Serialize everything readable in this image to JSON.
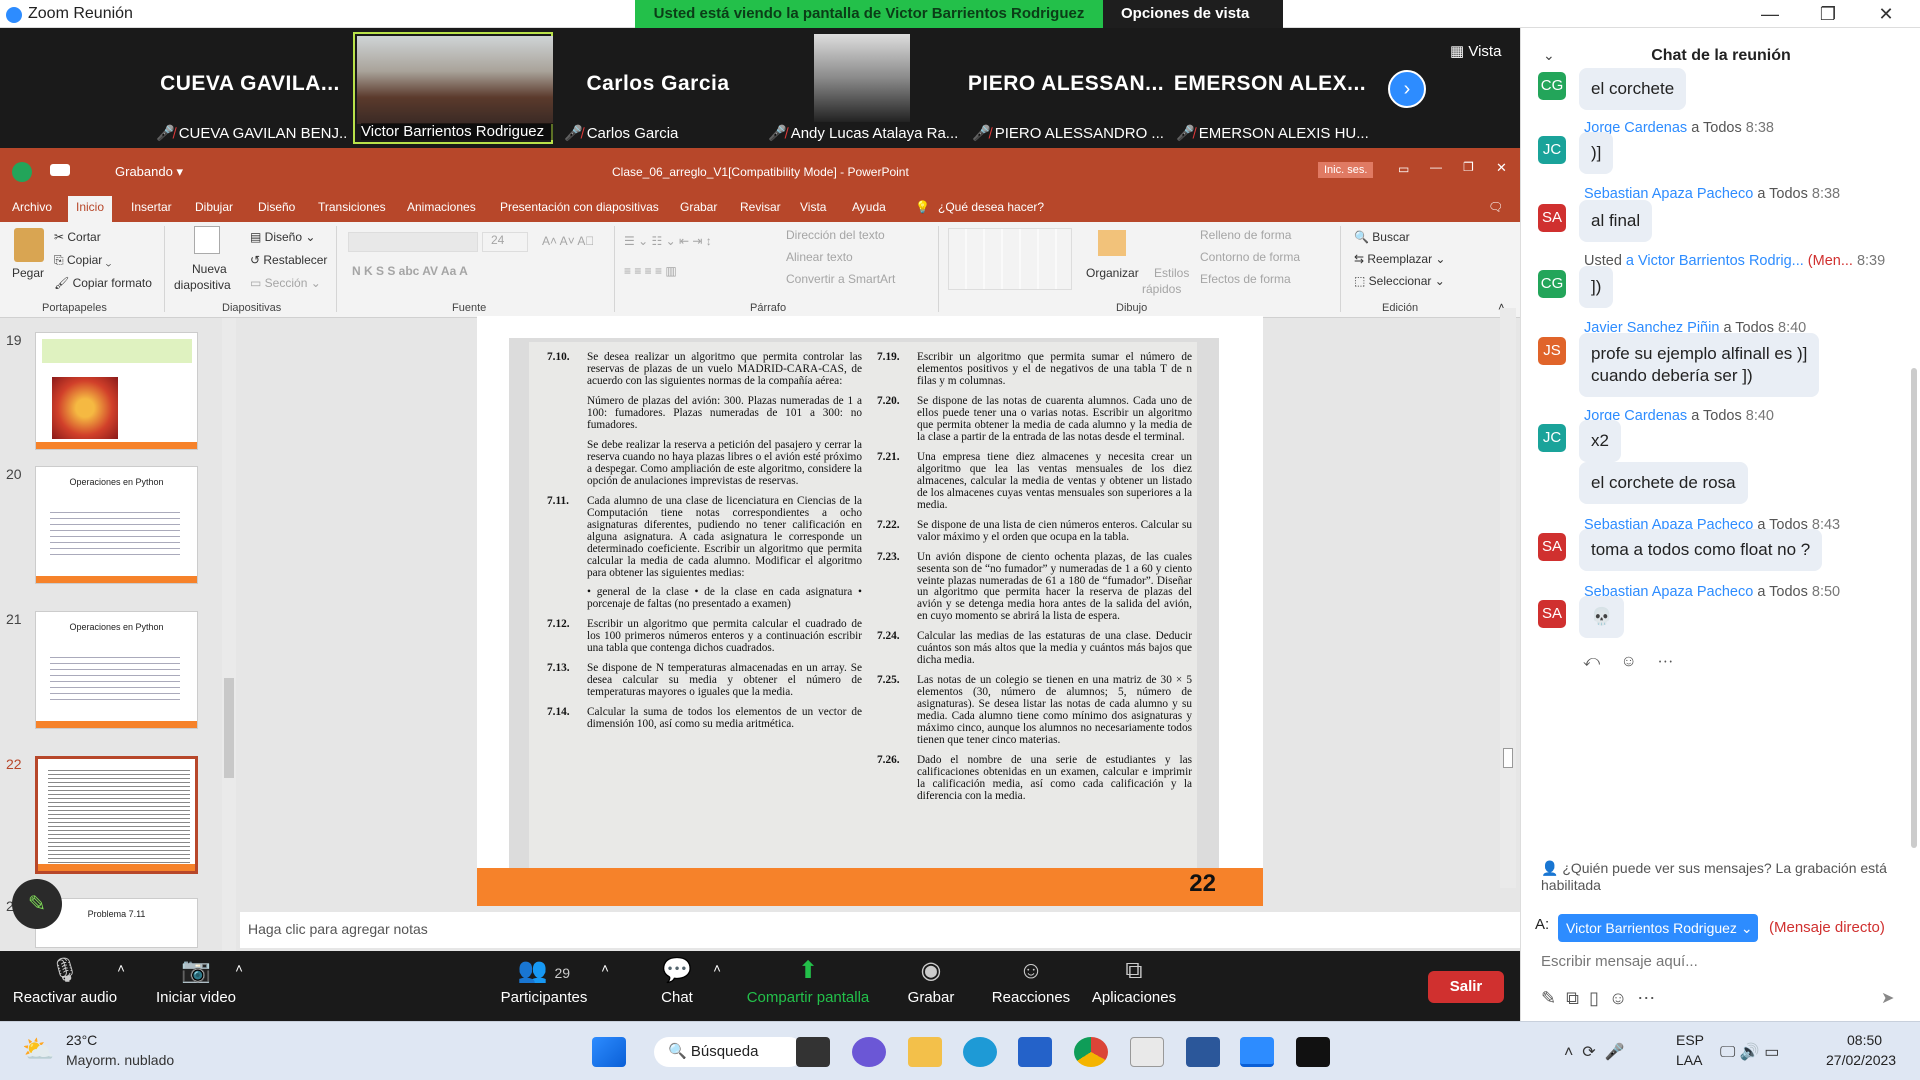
{
  "window": {
    "title": "Zoom Reunión",
    "banner": "Usted está viendo la pantalla de Victor Barrientos Rodriguez",
    "view_options": "Opciones de vista"
  },
  "gallery": {
    "tiles": [
      {
        "big": "CUEVA  GAVILA...",
        "label": "CUEVA GAVILAN BENJ..."
      },
      {
        "big": "",
        "label": "Victor Barrientos Rodriguez"
      },
      {
        "big": "Carlos Garcia",
        "label": "Carlos Garcia"
      },
      {
        "big": "",
        "label": "Andy Lucas Atalaya Ra..."
      },
      {
        "big": "PIERO  ALESSAN...",
        "label": "PIERO ALESSANDRO ..."
      },
      {
        "big": "EMERSON  ALEX...",
        "label": "EMERSON ALEXIS HU..."
      }
    ],
    "view_label": "Vista"
  },
  "ppt": {
    "recording": "Grabando",
    "doc_title": "Clase_06_arreglo_V1[Compatibility Mode]  -  PowerPoint",
    "signin": "Inic. ses.",
    "menu": [
      "Archivo",
      "Inicio",
      "Insertar",
      "Dibujar",
      "Diseño",
      "Transiciones",
      "Animaciones",
      "Presentación con diapositivas",
      "Grabar",
      "Revisar",
      "Vista",
      "Ayuda",
      "¿Qué desea hacer?"
    ],
    "ribbon": {
      "pegar": "Pegar",
      "cortar": "Cortar",
      "copiar": "Copiar",
      "copiar_formato": "Copiar formato",
      "nueva": "Nueva",
      "diapositiva": "diapositiva",
      "diseno": "Diseño",
      "restablecer": "Restablecer",
      "seccion": "Sección",
      "font_size": "24",
      "direccion": "Dirección del texto",
      "alinear": "Alinear texto",
      "smartart": "Convertir a SmartArt",
      "organizar": "Organizar",
      "estilos": "Estilos",
      "rapidos": "rápidos",
      "relleno": "Relleno de forma",
      "contorno": "Contorno de forma",
      "efectos": "Efectos de forma",
      "buscar": "Buscar",
      "reemplazar": "Reemplazar",
      "seleccionar": "Seleccionar",
      "groups": [
        "Portapapeles",
        "Diapositivas",
        "Fuente",
        "Párrafo",
        "Dibujo",
        "Edición"
      ]
    },
    "thumbs": [
      {
        "num": "19",
        "heading": ""
      },
      {
        "num": "20",
        "heading": "Operaciones  en Python"
      },
      {
        "num": "21",
        "heading": "Operaciones  en Python"
      },
      {
        "num": "22",
        "heading": ""
      },
      {
        "num": "23",
        "heading": "Problema 7.11"
      }
    ],
    "notes": "Haga clic para agregar notas",
    "slide_number": "22"
  },
  "page_text": {
    "left": [
      {
        "n": "7.10.",
        "t": "Se desea realizar un algoritmo que permita controlar las reservas de plazas de un vuelo MADRID-CARA-CAS, de acuerdo con las siguientes normas de la compañía aérea:"
      },
      {
        "n": "",
        "t": "Número de plazas del avión: 300. Plazas numeradas de 1 a 100: fumadores. Plazas numeradas de 101 a 300: no fumadores."
      },
      {
        "n": "",
        "t": "Se debe realizar la reserva a petición del pasajero y cerrar la reserva cuando no haya plazas libres o el avión esté próximo a despegar. Como ampliación de este algoritmo, considere la opción de anulaciones imprevistas de reservas."
      },
      {
        "n": "7.11.",
        "t": "Cada alumno de una clase de licenciatura en Ciencias de la Computación tiene notas correspondientes a ocho asignaturas diferentes, pudiendo no tener calificación en alguna asignatura. A cada asignatura le corresponde un determinado coeficiente. Escribir un algoritmo que permita calcular la media de cada alumno. Modificar el algoritmo para obtener las siguientes medias:"
      },
      {
        "n": "",
        "t": "• general de la clase • de la clase en cada asignatura • porcenaje de faltas (no presentado a examen)"
      },
      {
        "n": "7.12.",
        "t": "Escribir un algoritmo que permita calcular el cuadrado de los 100 primeros números enteros y a continuación escribir una tabla que contenga dichos cuadrados."
      },
      {
        "n": "7.13.",
        "t": "Se dispone de N temperaturas almacenadas en un array. Se desea calcular su media y obtener el número de temperaturas mayores o iguales que la media."
      },
      {
        "n": "7.14.",
        "t": "Calcular la suma de todos los elementos de un vector de dimensión 100, así como su media aritmética."
      }
    ],
    "right": [
      {
        "n": "7.19.",
        "t": "Escribir un algoritmo que permita sumar el número de elementos positivos y el de negativos de una tabla T de n filas y m columnas."
      },
      {
        "n": "7.20.",
        "t": "Se dispone de las notas de cuarenta alumnos. Cada uno de ellos puede tener una o varias notas. Escribir un algoritmo que permita obtener la media de cada alumno y la media de la clase a partir de la entrada de las notas desde el terminal."
      },
      {
        "n": "7.21.",
        "t": "Una empresa tiene diez almacenes y necesita crear un algoritmo que lea las ventas mensuales de los diez almacenes, calcular la media de ventas y obtener un listado de los almacenes cuyas ventas mensuales son superiores a la media."
      },
      {
        "n": "7.22.",
        "t": "Se dispone de una lista de cien números enteros. Calcular su valor máximo y el orden que ocupa en la tabla."
      },
      {
        "n": "7.23.",
        "t": "Un avión dispone de ciento ochenta plazas, de las cuales sesenta son de “no fumador” y numeradas de 1 a 60 y ciento veinte plazas numeradas de 61 a 180 de “fumador”. Diseñar un algoritmo que permita hacer la reserva de plazas del avión y se detenga media hora antes de la salida del avión, en cuyo momento se abrirá la lista de espera."
      },
      {
        "n": "7.24.",
        "t": "Calcular las medias de las estaturas de una clase. Deducir cuántos son más altos que la media y cuántos más bajos que dicha media."
      },
      {
        "n": "7.25.",
        "t": "Las notas de un colegio se tienen en una matriz de 30 × 5 elementos (30, número de alumnos; 5, número de asignaturas). Se desea listar las notas de cada alumno y su media. Cada alumno tiene como mínimo dos asignaturas y máximo cinco, aunque los alumnos no necesariamente todos tienen que tener cinco materias."
      },
      {
        "n": "7.26.",
        "t": "Dado el nombre de una serie de estudiantes y las calificaciones obtenidas en un examen, calcular e imprimir la calificación media, así como cada calificación y la diferencia con la media."
      }
    ]
  },
  "controls": {
    "audio": "Reactivar audio",
    "video": "Iniciar video",
    "participants": "Participantes",
    "participants_count": "29",
    "chat": "Chat",
    "share": "Compartir pantalla",
    "record": "Grabar",
    "reactions": "Reacciones",
    "apps": "Aplicaciones",
    "leave": "Salir"
  },
  "chat": {
    "header": "Chat de la reunión",
    "messages": [
      {
        "initials": "CG",
        "color": "#23a55a",
        "sender": "",
        "to": "",
        "time": "",
        "text": "el corchete"
      },
      {
        "initials": "JC",
        "color": "#1aa39a",
        "sender": "Jorge Cardenas",
        "to": "a Todos",
        "time": "8:38",
        "text": ")]"
      },
      {
        "initials": "SA",
        "color": "#d0302f",
        "sender": "Sebastian Apaza Pacheco",
        "to": "a Todos",
        "time": "8:38",
        "text": "al final"
      },
      {
        "initials": "CG",
        "color": "#23a55a",
        "sender": "Usted",
        "to": "a Victor Barrientos Rodrig...",
        "extra": "(Men...",
        "time": "8:39",
        "text": "])"
      },
      {
        "initials": "JS",
        "color": "#e0642a",
        "sender": "Javier Sanchez Piñin",
        "to": "a Todos",
        "time": "8:40",
        "text": "profe su ejemplo alfinall es )]\ncuando debería ser ])"
      },
      {
        "initials": "JC",
        "color": "#1aa39a",
        "sender": "Jorge Cardenas",
        "to": "a Todos",
        "time": "8:40",
        "text": "x2"
      },
      {
        "initials": "",
        "color": "",
        "sender": "",
        "to": "",
        "time": "",
        "text": "el corchete de rosa"
      },
      {
        "initials": "SA",
        "color": "#d0302f",
        "sender": "Sebastian Apaza Pacheco",
        "to": "a Todos",
        "time": "8:43",
        "text": "toma a todos como float no ?"
      },
      {
        "initials": "SA",
        "color": "#d0302f",
        "sender": "Sebastian Apaza Pacheco",
        "to": "a Todos",
        "time": "8:50",
        "text": "💀"
      }
    ],
    "who_can_see": "¿Quién puede ver sus mensajes? La grabación está habilitada",
    "to_label": "A:",
    "recipient": "Victor Barrientos Rodriguez",
    "direct": "(Mensaje directo)",
    "placeholder": "Escribir mensaje aquí..."
  },
  "taskbar": {
    "temp": "23°C",
    "weather": "Mayorm. nublado",
    "search": "Búsqueda",
    "lang1": "ESP",
    "lang2": "LAA",
    "time": "08:50",
    "date": "27/02/2023"
  }
}
